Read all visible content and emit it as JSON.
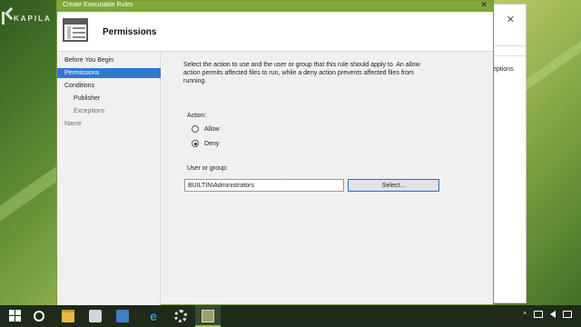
{
  "watermark": {
    "text": "KAPILA"
  },
  "background_window": {
    "partial_text": "eptions"
  },
  "window": {
    "title": "Create Executable Rules",
    "close_glyph": "✕"
  },
  "header": {
    "title": "Permissions",
    "icon": "rules-table-icon"
  },
  "sidebar": {
    "items": [
      {
        "label": "Before You Begin",
        "state": "normal"
      },
      {
        "label": "Permissions",
        "state": "selected"
      },
      {
        "label": "Conditions",
        "state": "normal"
      },
      {
        "label": "Publisher",
        "state": "sub"
      },
      {
        "label": "Exceptions",
        "state": "sub-disabled"
      },
      {
        "label": "Name",
        "state": "disabled"
      }
    ]
  },
  "content": {
    "description": "Select the action to use and the user or group that this rule should apply to. An allow action permits affected files to run, while a deny action prevents affected files from running.",
    "action_label": "Action:",
    "options": [
      {
        "label": "Allow",
        "checked": false
      },
      {
        "label": "Deny",
        "checked": true
      }
    ],
    "user_label": "User or group:",
    "user_value": "BUILTIN\\Administrators",
    "select_button": "Select..."
  },
  "taskbar": {
    "icons": [
      "start-icon",
      "cortana-icon",
      "folder-icon",
      "paint-icon",
      "monitor-icon",
      "internet-explorer-icon",
      "settings-gear-icon",
      "applocker-app-icon"
    ],
    "active": "applocker-app-icon",
    "tray": [
      "chevron-up-icon",
      "display-icon",
      "volume-icon",
      "notification-icon"
    ]
  },
  "colors": {
    "titlebar": "#7fa83a",
    "selection": "#3377d0",
    "button_border": "#2f6fc0"
  }
}
